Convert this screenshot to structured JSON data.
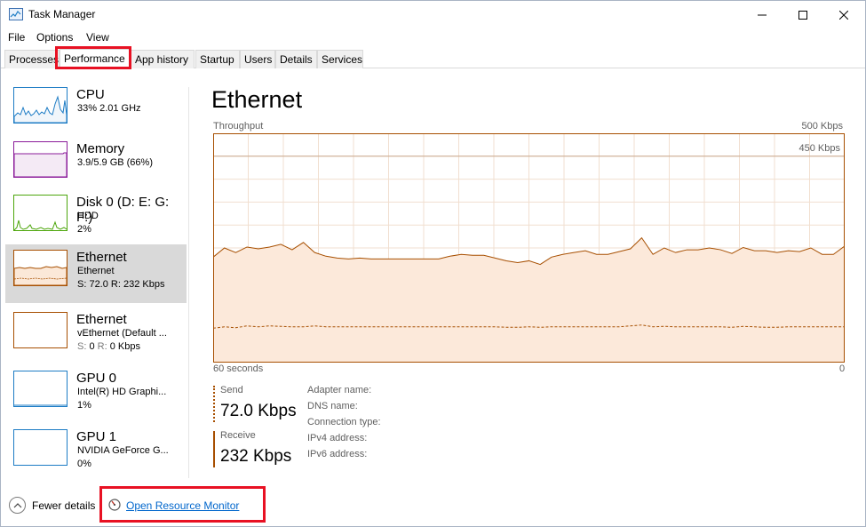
{
  "window": {
    "title": "Task Manager"
  },
  "menu": [
    "File",
    "Options",
    "View"
  ],
  "tabs": [
    {
      "label": "Processes",
      "active": false
    },
    {
      "label": "Performance",
      "active": true
    },
    {
      "label": "App history",
      "active": false
    },
    {
      "label": "Startup",
      "active": false
    },
    {
      "label": "Users",
      "active": false
    },
    {
      "label": "Details",
      "active": false
    },
    {
      "label": "Services",
      "active": false
    }
  ],
  "sidebar": {
    "items": [
      {
        "title": "CPU",
        "sub1": "33%  2.01 GHz",
        "sub2": "",
        "color": "#1d7cc5"
      },
      {
        "title": "Memory",
        "sub1": "3.9/5.9 GB (66%)",
        "sub2": "",
        "color": "#8b1c9a"
      },
      {
        "title": "Disk 0 (D: E: G: F:)",
        "sub1": "HDD",
        "sub2": "2%",
        "color": "#4da60c"
      },
      {
        "title": "Ethernet",
        "sub1": "Ethernet",
        "sub2": "S: 72.0  R: 232 Kbps",
        "color": "#a74f01",
        "selected": true
      },
      {
        "title": "Ethernet",
        "sub1": "vEthernet (Default ...",
        "sub2_s": "S:",
        "sub2_s_val": "0",
        "sub2_r": "R:",
        "sub2_r_val": "0 Kbps",
        "color": "#a74f01"
      },
      {
        "title": "GPU 0",
        "sub1": "Intel(R) HD Graphi...",
        "sub2": "1%",
        "color": "#1d7cc5"
      },
      {
        "title": "GPU 1",
        "sub1": "NVIDIA GeForce G...",
        "sub2": "0%",
        "color": "#1d7cc5"
      }
    ]
  },
  "main": {
    "title": "Ethernet",
    "graph_label": "Throughput",
    "graph_max": "500 Kbps",
    "graph_scale_line": "450 Kbps",
    "x_left": "60 seconds",
    "x_right": "0",
    "accent": "#a74f01",
    "fill": "#fce9da"
  },
  "chart_data": {
    "type": "area",
    "title": "Throughput",
    "xlabel": "",
    "ylabel": "",
    "xlim": [
      60,
      0
    ],
    "ylim": [
      0,
      500
    ],
    "x_labels": [
      "60 seconds",
      "0"
    ],
    "scale_line": 450,
    "grid": true,
    "series": [
      {
        "name": "Receive",
        "style": "solid-filled",
        "values": [
          230,
          250,
          240,
          252,
          248,
          252,
          258,
          246,
          262,
          240,
          232,
          228,
          226,
          228,
          226,
          226,
          226,
          226,
          226,
          226,
          226,
          232,
          236,
          234,
          234,
          228,
          222,
          218,
          222,
          214,
          230,
          236,
          240,
          244,
          236,
          236,
          242,
          248,
          272,
          236,
          250,
          240,
          246,
          246,
          250,
          246,
          238,
          251,
          244,
          244,
          240,
          244,
          242,
          250,
          236,
          236,
          254
        ]
      },
      {
        "name": "Send",
        "style": "dashed",
        "values": [
          75,
          78,
          76,
          80,
          78,
          80,
          79,
          78,
          78,
          80,
          78,
          78,
          78,
          78,
          78,
          78,
          78,
          78,
          78,
          78,
          78,
          78,
          78,
          78,
          78,
          78,
          77,
          77,
          78,
          77,
          78,
          78,
          78,
          78,
          78,
          78,
          78,
          80,
          82,
          78,
          79,
          78,
          78,
          78,
          78,
          78,
          77,
          79,
          78,
          77,
          77,
          78,
          78,
          78,
          78,
          78,
          78
        ]
      }
    ]
  },
  "stats": {
    "send_label": "Send",
    "send_value": "72.0 Kbps",
    "receive_label": "Receive",
    "receive_value": "232 Kbps"
  },
  "properties": [
    "Adapter name:",
    "DNS name:",
    "Connection type:",
    "IPv4 address:",
    "IPv6 address:"
  ],
  "footer": {
    "fewer_details": "Fewer details",
    "resource_monitor": "Open Resource Monitor"
  }
}
